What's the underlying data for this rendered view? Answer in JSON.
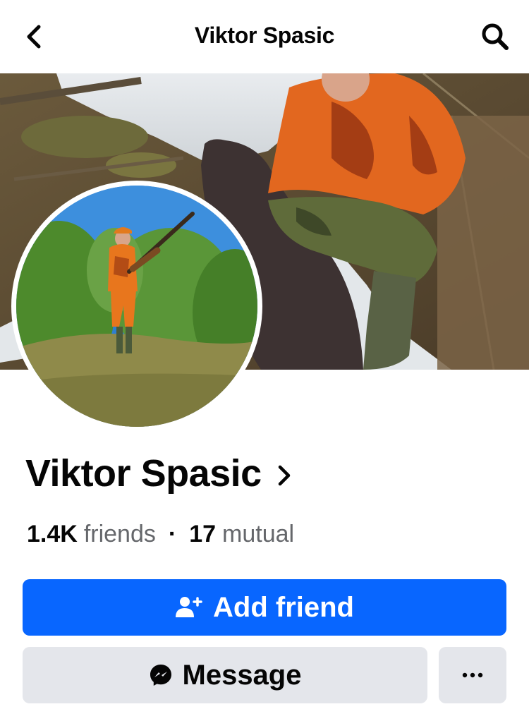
{
  "header": {
    "title": "Viktor Spasic",
    "back_icon": "chevron-left-icon",
    "search_icon": "search-icon"
  },
  "profile": {
    "name": "Viktor Spasic",
    "friends_count": "1.4K",
    "friends_label": "friends",
    "separator": "·",
    "mutual_count": "17",
    "mutual_label": "mutual"
  },
  "actions": {
    "add_friend_label": "Add friend",
    "add_friend_icon": "add-person-icon",
    "message_label": "Message",
    "message_icon": "messenger-icon",
    "more_icon": "more-horizontal-icon"
  },
  "colors": {
    "primary_button": "#0866ff",
    "secondary_button": "#e4e6eb",
    "secondary_text": "#65676b"
  }
}
